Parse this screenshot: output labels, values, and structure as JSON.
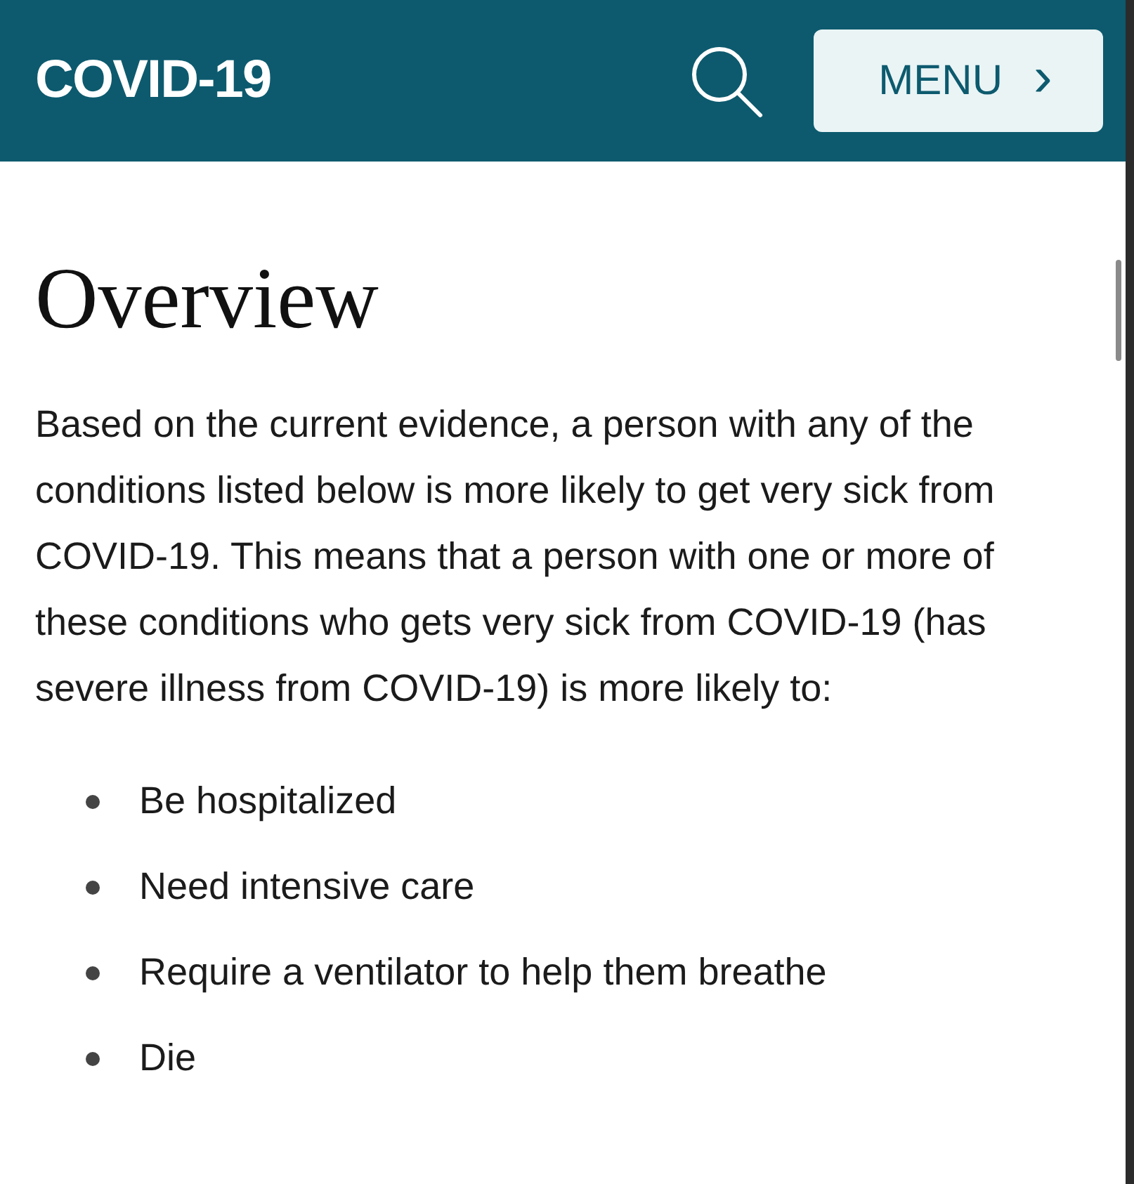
{
  "header": {
    "title": "COVID-19",
    "menu_button": "MENU",
    "menu_chevron": "›"
  },
  "content": {
    "heading": "Overview",
    "paragraph": "Based on the current evidence, a person with any of the conditions listed below is more likely to get very sick from COVID-19. This means that a person with one or more of these conditions who gets very sick from COVID-19 (has severe illness from COVID-19) is more likely to:",
    "bullets": [
      "Be hospitalized",
      "Need intensive care",
      "Require a ventilator to help them breathe",
      "Die"
    ]
  }
}
